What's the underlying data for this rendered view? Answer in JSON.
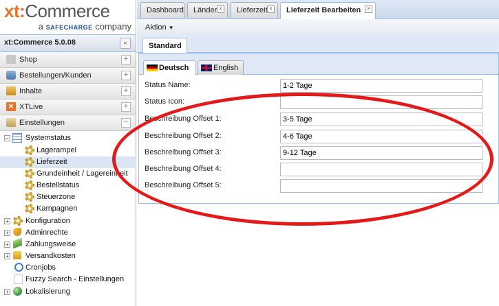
{
  "brand": {
    "logo_main": "xt:Commerce",
    "logo_sub_prefix": "a",
    "logo_sub_brand": "SAFECHARGE",
    "logo_sub_suffix": "company"
  },
  "sidebar": {
    "version": "xt:Commerce 5.0.08",
    "sections": [
      {
        "label": "Shop",
        "icon": "shop-icon"
      },
      {
        "label": "Bestellungen/Kunden",
        "icon": "cart-icon"
      },
      {
        "label": "Inhalte",
        "icon": "content-icon"
      },
      {
        "label": "XTLive",
        "icon": "xtlive-icon"
      },
      {
        "label": "Einstellungen",
        "icon": "settings-icon"
      }
    ],
    "tree": [
      {
        "label": "Systemstatus",
        "icon": "table-icon"
      },
      {
        "label": "Lagerampel",
        "icon": "gear-icon"
      },
      {
        "label": "Lieferzeit",
        "icon": "gear-icon"
      },
      {
        "label": "Grundeinheit / Lagereinheit",
        "icon": "gear-icon"
      },
      {
        "label": "Bestellstatus",
        "icon": "gear-icon"
      },
      {
        "label": "Steuerzone",
        "icon": "gear-icon"
      },
      {
        "label": "Kampagnen",
        "icon": "gear-icon"
      },
      {
        "label": "Konfiguration",
        "icon": "gear-icon"
      },
      {
        "label": "Adminrechte",
        "icon": "key-icon"
      },
      {
        "label": "Zahlungsweise",
        "icon": "money-icon"
      },
      {
        "label": "Versandkosten",
        "icon": "box-icon"
      },
      {
        "label": "Cronjobs",
        "icon": "clock-icon"
      },
      {
        "label": "Fuzzy Search - Einstellungen",
        "icon": "search-icon"
      },
      {
        "label": "Lokalisierung",
        "icon": "globe-icon"
      }
    ]
  },
  "tabs": [
    {
      "label": "Dashboard"
    },
    {
      "label": "Länder"
    },
    {
      "label": "Lieferzeit"
    },
    {
      "label": "Lieferzeit Bearbeiten"
    }
  ],
  "toolbar": {
    "action_label": "Aktion"
  },
  "subtab": {
    "label": "Standard"
  },
  "languages": [
    {
      "label": "Deutsch"
    },
    {
      "label": "English"
    }
  ],
  "form": {
    "fields": [
      {
        "label": "Status Name:",
        "value": "1-2 Tage"
      },
      {
        "label": "Status Icon:",
        "value": ""
      },
      {
        "label": "Beschreibung Offset 1:",
        "value": "3-5 Tage"
      },
      {
        "label": "Beschreibung Offset 2:",
        "value": "4-6 Tage"
      },
      {
        "label": "Beschreibung Offset 3:",
        "value": "9-12 Tage"
      },
      {
        "label": "Beschreibung Offset 4:",
        "value": ""
      },
      {
        "label": "Beschreibung Offset 5:",
        "value": ""
      }
    ]
  },
  "colors": {
    "brand_orange": "#e8742a",
    "highlight_red": "#e21a1a",
    "panel_blue": "#dfe8f6"
  }
}
